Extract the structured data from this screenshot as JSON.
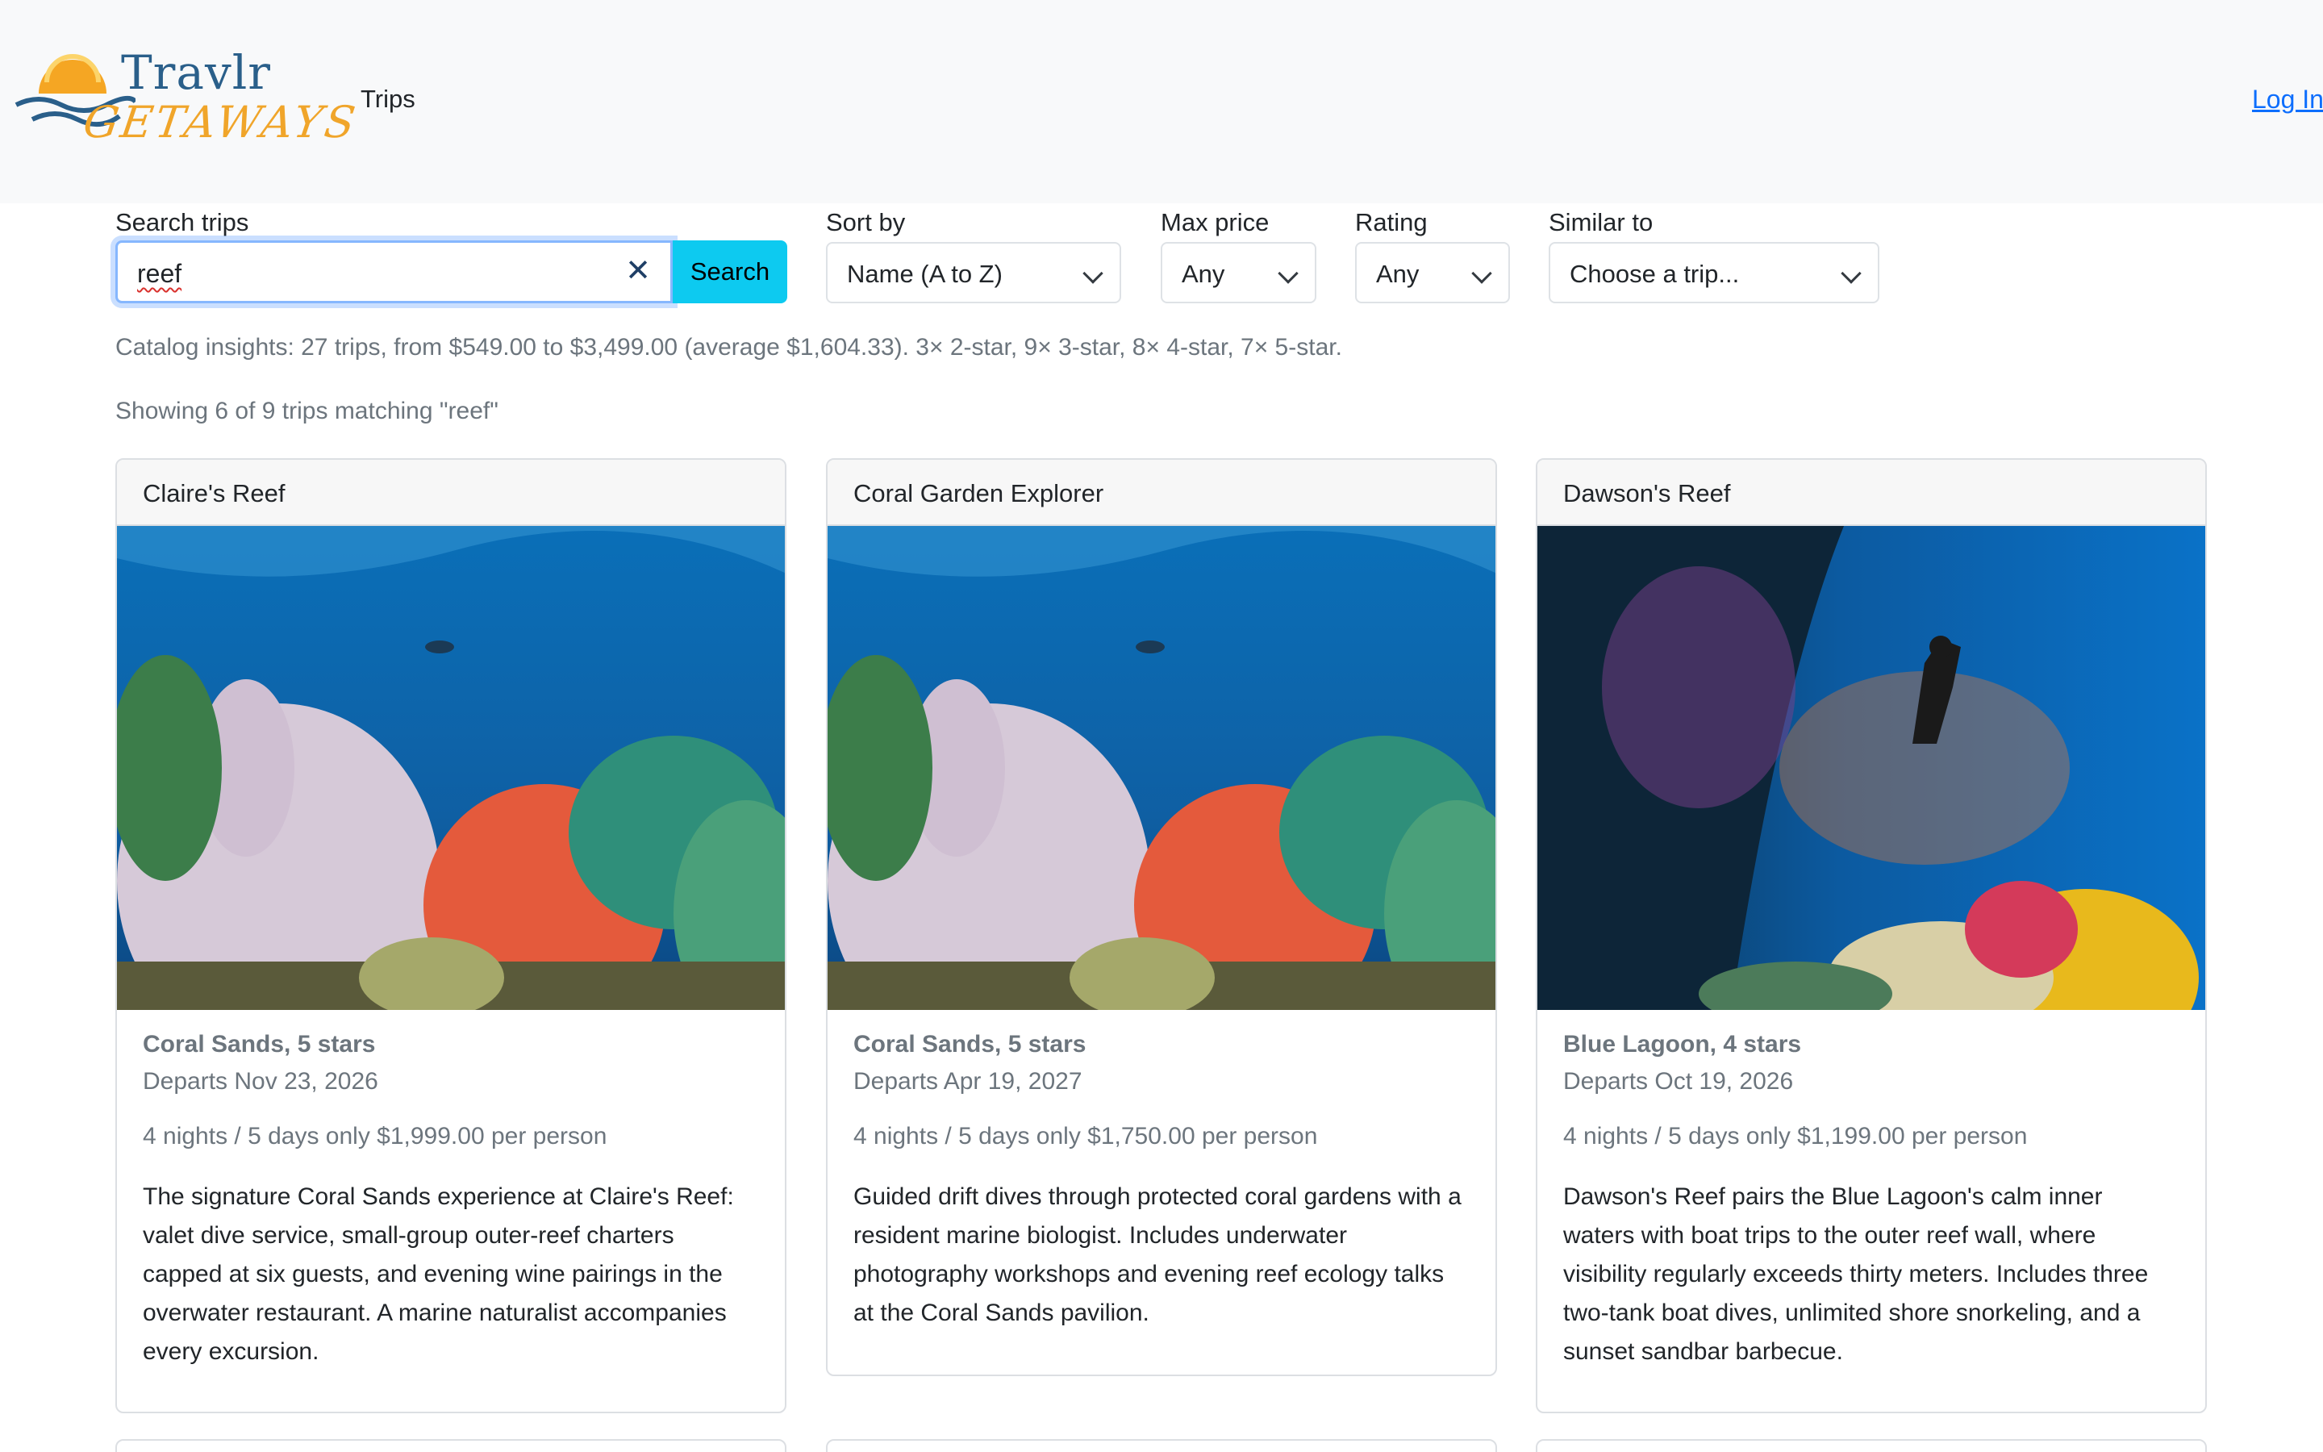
{
  "header": {
    "logo_top": "Travlr",
    "logo_bottom": "GETAWAYS",
    "nav_trips": "Trips",
    "login": "Log In"
  },
  "filters": {
    "search_label": "Search trips",
    "search_value": "reef",
    "clear_glyph": "✕",
    "search_button": "Search",
    "sort_label": "Sort by",
    "sort_value": "Name (A to Z)",
    "maxprice_label": "Max price",
    "maxprice_value": "Any",
    "rating_label": "Rating",
    "rating_value": "Any",
    "similar_label": "Similar to",
    "similar_value": "Choose a trip..."
  },
  "insights": "Catalog insights: 27 trips, from $549.00 to $3,499.00 (average $1,604.33). 3× 2-star, 9× 3-star, 8× 4-star, 7× 5-star.",
  "showing": "Showing 6 of 9 trips matching \"reef\"",
  "cards": [
    {
      "title": "Claire's Reef",
      "resort": "Coral Sands, 5 stars",
      "departs": "Departs Nov 23, 2026",
      "price": "4 nights / 5 days only $1,999.00 per person",
      "desc": "The signature Coral Sands experience at Claire's Reef: valet dive service, small-group outer-reef charters capped at six guests, and evening wine pairings in the overwater restaurant. A marine naturalist accompanies every excursion."
    },
    {
      "title": "Coral Garden Explorer",
      "resort": "Coral Sands, 5 stars",
      "departs": "Departs Apr 19, 2027",
      "price": "4 nights / 5 days only $1,750.00 per person",
      "desc": "Guided drift dives through protected coral gardens with a resident marine biologist. Includes underwater photography workshops and evening reef ecology talks at the Coral Sands pavilion."
    },
    {
      "title": "Dawson's Reef",
      "resort": "Blue Lagoon, 4 stars",
      "departs": "Departs Oct 19, 2026",
      "price": "4 nights / 5 days only $1,199.00 per person",
      "desc": "Dawson's Reef pairs the Blue Lagoon's calm inner waters with boat trips to the outer reef wall, where visibility regularly exceeds thirty meters. Includes three two-tank boat dives, unlimited shore snorkeling, and a sunset sandbar barbecue."
    }
  ],
  "colors": {
    "accent": "#0dcaf0",
    "link": "#0d6efd",
    "header_bg": "#f8f9fa",
    "logo_blue": "#2a5f8a",
    "logo_orange": "#f0a52a"
  }
}
